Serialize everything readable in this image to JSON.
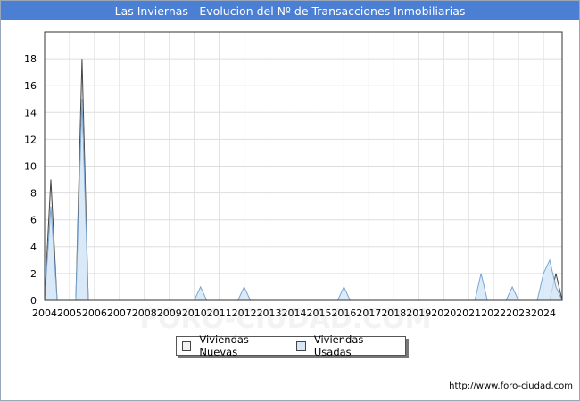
{
  "header": {
    "title": "Las Inviernas - Evolucion del Nº de Transacciones Inmobiliarias"
  },
  "footer": {
    "url": "http://www.foro-ciudad.com"
  },
  "watermark": "FORO-CIUDAD.COM",
  "chart_data": {
    "type": "area",
    "title": "Las Inviernas - Evolucion del Nº de Transacciones Inmobiliarias",
    "xlabel": "",
    "ylabel": "",
    "x_ticks": [
      "2004",
      "2005",
      "2006",
      "2007",
      "2008",
      "2009",
      "2010",
      "2011",
      "2012",
      "2013",
      "2014",
      "2015",
      "2016",
      "2017",
      "2018",
      "2019",
      "2020",
      "2021",
      "2022",
      "2023",
      "2024"
    ],
    "xlim": [
      2004,
      2024.75
    ],
    "ylim": [
      0,
      20
    ],
    "y_ticks": [
      0,
      2,
      4,
      6,
      8,
      10,
      12,
      14,
      16,
      18
    ],
    "grid": true,
    "legend_position": "bottom-center",
    "series": [
      {
        "name": "Viviendas Nuevas",
        "color": "#f2f2f2",
        "stroke": "#444444",
        "x": [
          2004.0,
          2004.25,
          2004.5,
          2004.75,
          2005.0,
          2005.25,
          2005.5,
          2005.75,
          2006.0,
          2024.0,
          2024.25,
          2024.5,
          2024.75
        ],
        "y": [
          0,
          9,
          0,
          0,
          0,
          0,
          18,
          0,
          0,
          0,
          0,
          2,
          0
        ]
      },
      {
        "name": "Viviendas Usadas",
        "color": "#d6e8f8",
        "stroke": "#7aa5cf",
        "x": [
          2004.0,
          2004.25,
          2004.5,
          2005.0,
          2005.25,
          2005.5,
          2005.75,
          2010.0,
          2010.25,
          2010.5,
          2011.75,
          2012.0,
          2012.25,
          2015.75,
          2016.0,
          2016.25,
          2021.25,
          2021.5,
          2021.75,
          2022.5,
          2022.75,
          2023.0,
          2023.75,
          2024.0,
          2024.25,
          2024.5,
          2024.75
        ],
        "y": [
          0,
          7,
          0,
          0,
          0,
          15,
          0,
          0,
          1,
          0,
          0,
          1,
          0,
          0,
          1,
          0,
          0,
          2,
          0,
          0,
          1,
          0,
          0,
          2,
          3,
          1,
          0
        ]
      }
    ]
  }
}
